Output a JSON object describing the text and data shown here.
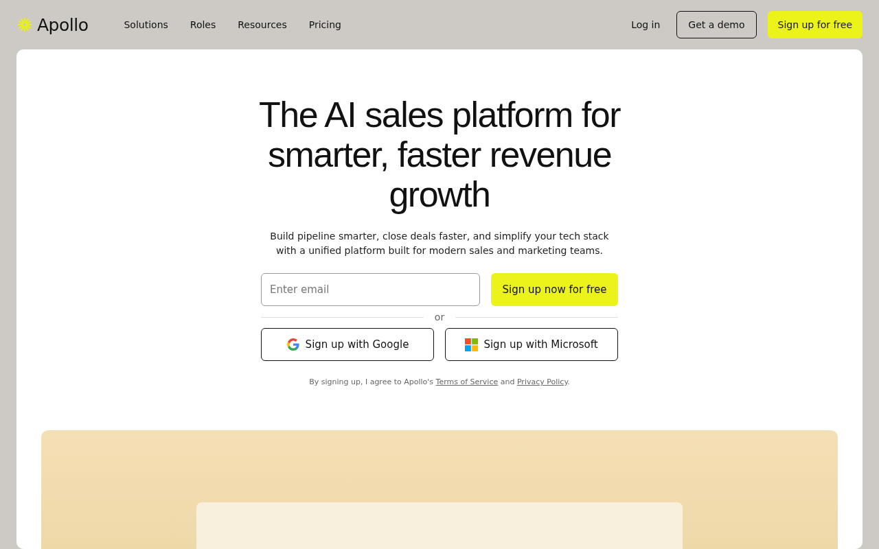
{
  "header": {
    "logo": "Apollo",
    "nav": [
      {
        "label": "Solutions"
      },
      {
        "label": "Roles"
      },
      {
        "label": "Resources"
      },
      {
        "label": "Pricing"
      }
    ],
    "login": "Log in",
    "demo": "Get a demo",
    "signup": "Sign up for free"
  },
  "hero": {
    "title": "The AI sales platform for smarter, faster revenue growth",
    "subtitle": "Build pipeline smarter, close deals faster, and simplify your tech stack with a unified platform built for modern sales and marketing teams.",
    "email": {
      "placeholder": "Enter email"
    },
    "submit": "Sign up now for free",
    "divider": "or",
    "sso": [
      {
        "kind": "google",
        "label": "Sign up with Google"
      },
      {
        "kind": "microsoft",
        "label": "Sign up with Microsoft"
      }
    ],
    "legal": {
      "before": "By signing up, I agree to Apollo's ",
      "terms": "Terms of Service",
      "middle": " and ",
      "privacy": "Privacy Policy",
      "after": "."
    }
  }
}
